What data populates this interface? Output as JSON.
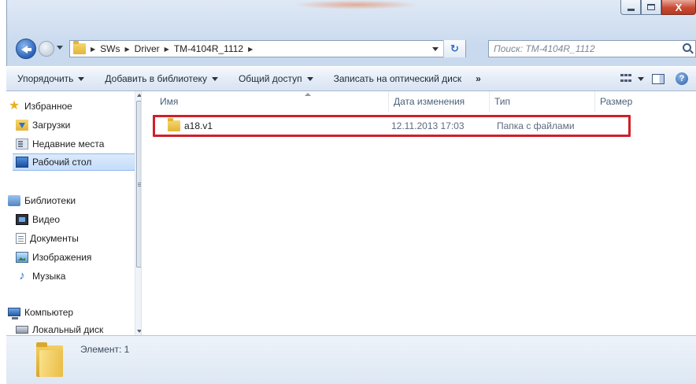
{
  "window": {
    "caption_buttons": [
      "minimize",
      "maximize",
      "close"
    ],
    "close_glyph": "X"
  },
  "address": {
    "path": [
      "SWs",
      "Driver",
      "TM-4104R_1112"
    ],
    "refresh_glyph": "↻"
  },
  "search": {
    "placeholder": "Поиск: TM-4104R_1112"
  },
  "toolbar": {
    "organize": "Упорядочить",
    "add_to_library": "Добавить в библиотеку",
    "share": "Общий доступ",
    "burn": "Записать на оптический диск",
    "more": "»",
    "help": "?"
  },
  "sidebar": {
    "favorites": {
      "label": "Избранное",
      "items": [
        "Загрузки",
        "Недавние места",
        "Рабочий стол"
      ]
    },
    "libraries": {
      "label": "Библиотеки",
      "items": [
        "Видео",
        "Документы",
        "Изображения",
        "Музыка"
      ]
    },
    "computer": {
      "label": "Компьютер",
      "items": [
        "Локальный диск"
      ]
    },
    "selected": "Рабочий стол"
  },
  "columns": {
    "name": "Имя",
    "date": "Дата изменения",
    "type": "Тип",
    "size": "Размер"
  },
  "files": [
    {
      "name": "a18.v1",
      "date": "12.11.2013 17:03",
      "type": "Папка с файлами",
      "size": ""
    }
  ],
  "details": {
    "count_text": "Элемент: 1"
  },
  "colors": {
    "highlight": "#d01f2a",
    "accent": "#2b63b8"
  }
}
